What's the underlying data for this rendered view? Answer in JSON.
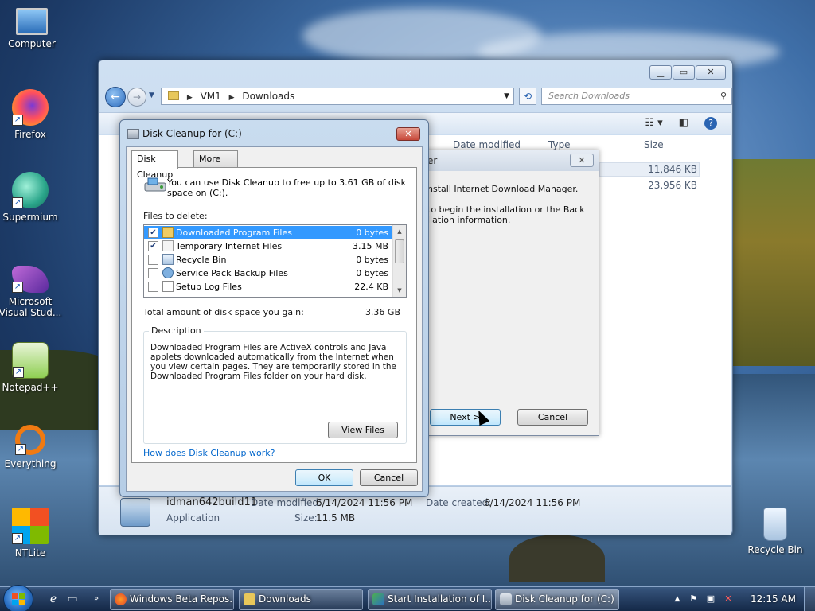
{
  "desktop": {
    "icons": [
      {
        "label": "Computer",
        "icon": "computer-icon"
      },
      {
        "label": "Firefox",
        "icon": "firefox-icon"
      },
      {
        "label": "Supermium",
        "icon": "supermium-icon"
      },
      {
        "label": "Microsoft Visual Stud...",
        "icon": "visual-studio-icon"
      },
      {
        "label": "Notepad++",
        "icon": "notepadpp-icon"
      },
      {
        "label": "Everything",
        "icon": "everything-icon"
      },
      {
        "label": "NTLite",
        "icon": "ntlite-icon"
      },
      {
        "label": "Recycle Bin",
        "icon": "recycle-bin-icon"
      }
    ]
  },
  "explorer": {
    "breadcrumb": [
      "VM1",
      "Downloads"
    ],
    "search_placeholder": "Search Downloads",
    "columns": [
      "Date modified",
      "Type",
      "Size"
    ],
    "sizes": [
      "11,846 KB",
      "23,956 KB"
    ],
    "details": {
      "name": "idman642build11",
      "date_modified_label": "Date modified:",
      "date_modified": "6/14/2024 11:56 PM",
      "date_created_label": "Date created:",
      "date_created": "6/14/2024 11:56 PM",
      "type": "Application",
      "size_label": "Size:",
      "size": "11.5 MB"
    }
  },
  "installer": {
    "title_fragment": "er",
    "line1": "nstall Internet Download Manager.",
    "line2": "to begin the installation or the Back",
    "line3": "llation information.",
    "next_label": "Next >",
    "cancel_label": "Cancel"
  },
  "cleanup": {
    "title": "Disk Cleanup for  (C:)",
    "tabs": [
      "Disk Cleanup",
      "More Options"
    ],
    "intro": "You can use Disk Cleanup to free up to 3.61 GB of disk space on  (C:).",
    "files_to_delete_label": "Files to delete:",
    "files": [
      {
        "name": "Downloaded Program Files",
        "size": "0 bytes",
        "checked": true,
        "selected": true
      },
      {
        "name": "Temporary Internet Files",
        "size": "3.15 MB",
        "checked": true,
        "selected": false
      },
      {
        "name": "Recycle Bin",
        "size": "0 bytes",
        "checked": false,
        "selected": false
      },
      {
        "name": "Service Pack Backup Files",
        "size": "0 bytes",
        "checked": false,
        "selected": false
      },
      {
        "name": "Setup Log Files",
        "size": "22.4 KB",
        "checked": false,
        "selected": false
      }
    ],
    "total_label": "Total amount of disk space you gain:",
    "total_value": "3.36 GB",
    "description_label": "Description",
    "description": "Downloaded Program Files are ActiveX controls and Java applets downloaded automatically from the Internet when you view certain pages. They are temporarily stored in the Downloaded Program Files folder on your hard disk.",
    "view_files_label": "View Files",
    "help_link": "How does Disk Cleanup work?",
    "ok_label": "OK",
    "cancel_label": "Cancel"
  },
  "taskbar": {
    "buttons": [
      {
        "label": "Windows Beta Repos...",
        "active": false
      },
      {
        "label": "Downloads",
        "active": false
      },
      {
        "label": "Start Installation of I...",
        "active": false
      },
      {
        "label": "Disk Cleanup for  (C:)",
        "active": true
      }
    ],
    "clock": "12:15 AM"
  }
}
